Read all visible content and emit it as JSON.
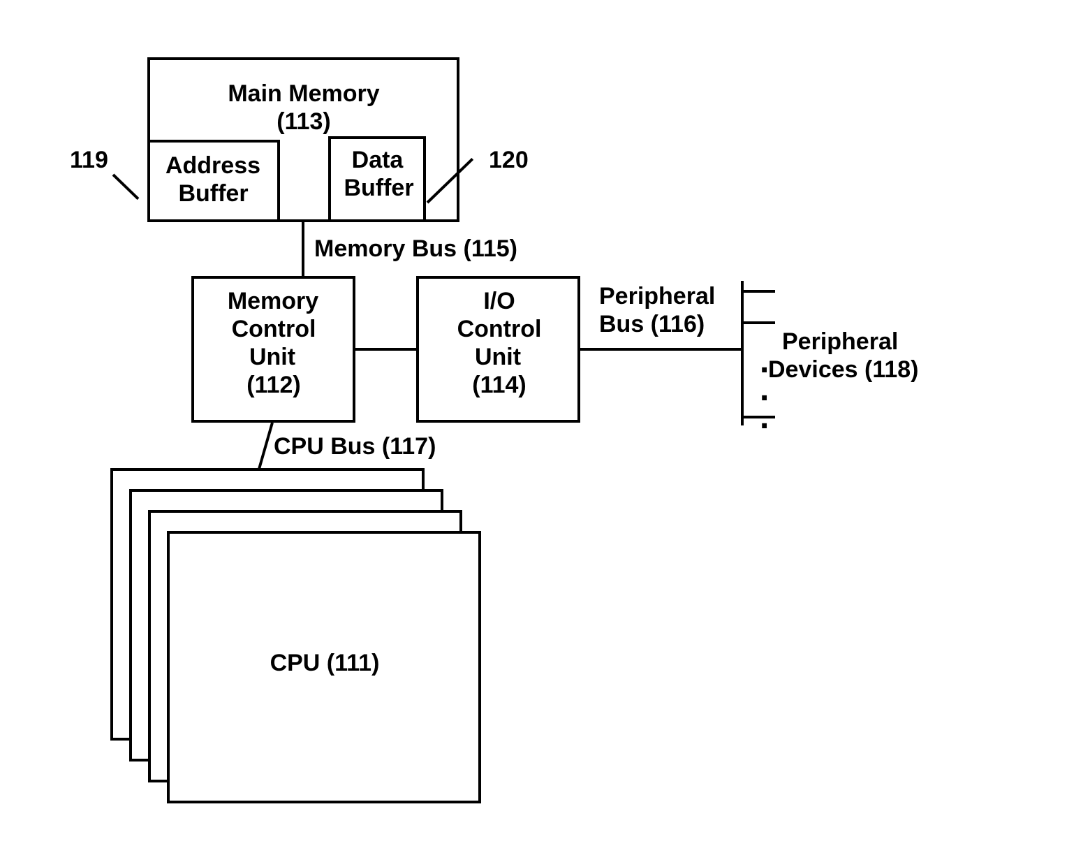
{
  "main_memory": {
    "title_l1": "Main Memory",
    "title_l2": "(113)"
  },
  "address_buffer": {
    "l1": "Address",
    "l2": "Buffer"
  },
  "data_buffer": {
    "l1": "Data",
    "l2": "Buffer"
  },
  "ref_119": "119",
  "ref_120": "120",
  "memory_bus": "Memory Bus (115)",
  "memory_control_unit": {
    "l1": "Memory",
    "l2": "Control",
    "l3": "Unit",
    "l4": "(112)"
  },
  "io_control_unit": {
    "l1": "I/O",
    "l2": "Control",
    "l3": "Unit",
    "l4": "(114)"
  },
  "peripheral_bus": {
    "l1": "Peripheral",
    "l2": "Bus (116)"
  },
  "peripheral_devices": {
    "l1": "Peripheral",
    "l2": "Devices (118)"
  },
  "cpu_bus": "CPU Bus (117)",
  "cpu": "CPU (111)",
  "dots": "."
}
